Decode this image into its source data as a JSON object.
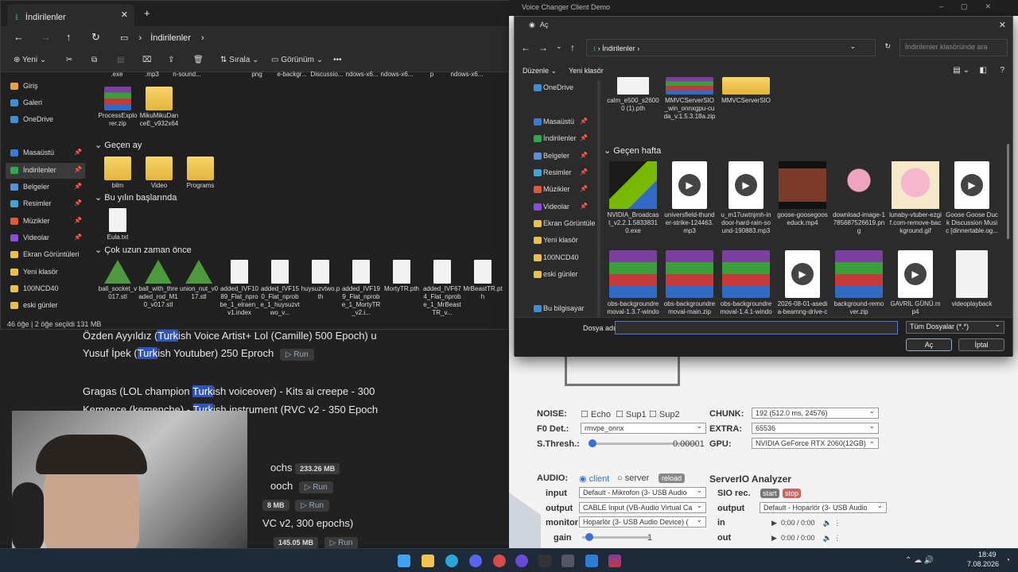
{
  "explorer": {
    "tab_title": "İndirilenler",
    "new_tab": "+",
    "address": "İndirilenler",
    "commands": {
      "new": "Yeni",
      "sort": "Sırala",
      "view": "Görünüm",
      "more": "•••"
    },
    "sidebar": [
      {
        "label": "Giriş",
        "color": "#e8a33c",
        "pinned": false
      },
      {
        "label": "Galeri",
        "color": "#3f8ed8",
        "pinned": false
      },
      {
        "label": "OneDrive",
        "color": "#3f8ed8",
        "pinned": false
      },
      {
        "label": "Masaüstü",
        "color": "#3a7bd5",
        "pinned": true
      },
      {
        "label": "İndirilenler",
        "color": "#2fa84f",
        "pinned": true
      },
      {
        "label": "Belgeler",
        "color": "#5a8fd8",
        "pinned": true
      },
      {
        "label": "Resimler",
        "color": "#3fa5d8",
        "pinned": true
      },
      {
        "label": "Müzikler",
        "color": "#e05a3a",
        "pinned": true
      },
      {
        "label": "Videolar",
        "color": "#8a4fd8",
        "pinned": true
      },
      {
        "label": "Ekran Görüntüleri",
        "color": "#e8c04a",
        "pinned": false
      },
      {
        "label": "Yeni klasör",
        "color": "#e8c04a",
        "pinned": false
      },
      {
        "label": "100NCD40",
        "color": "#e8c04a",
        "pinned": false
      },
      {
        "label": "eski günler",
        "color": "#e8c04a",
        "pinned": false
      }
    ],
    "top_row_cut": [
      ".exe",
      ".mp3",
      "n-sound...",
      "",
      "png",
      "e-backgr...",
      "Discussio...",
      "ndows-x6...",
      "ndows-x6...",
      "p",
      "ndows-x6..."
    ],
    "row1": [
      {
        "name": "ProcessExplorer.zip",
        "icon": "rar"
      },
      {
        "name": "MikuMikuDanceE_v932x64",
        "icon": "folder"
      }
    ],
    "group_last_month": "Geçen ay",
    "row2": [
      {
        "name": "bilm",
        "icon": "folder"
      },
      {
        "name": "Video",
        "icon": "folder"
      },
      {
        "name": "Programs",
        "icon": "folder"
      }
    ],
    "group_this_year": "Bu yılın başlarında",
    "row3": [
      {
        "name": "Eula.txt",
        "icon": "doc"
      }
    ],
    "group_long_ago": "Çok uzun zaman önce",
    "row4": [
      {
        "name": "ball_socket_v017.stl",
        "icon": "stl"
      },
      {
        "name": "ball_with_threaded_rod_M10_v017.stl",
        "icon": "stl"
      },
      {
        "name": "union_nut_v017.stl",
        "icon": "stl"
      },
      {
        "name": "added_IVF1089_Flat_nprobe_1_elraen_v1.index",
        "icon": "doc"
      },
      {
        "name": "added_IVF150_Flat_nprobe_1_huysuzvtwo_v...",
        "icon": "doc"
      },
      {
        "name": "huysuzvtwo.pth",
        "icon": "doc"
      },
      {
        "name": "added_IVF199_Flat_nprobe_1_MortyTR_v2.i...",
        "icon": "doc"
      },
      {
        "name": "MortyTR.pth",
        "icon": "doc"
      },
      {
        "name": "added_IVF674_Flat_nprobe_1_MrBeastTR_v...",
        "icon": "doc"
      },
      {
        "name": "MrBeastTR.pth",
        "icon": "doc"
      }
    ],
    "status": "46 öğe   |   2 öğe seçildi  131 MB"
  },
  "bgpage": {
    "line1_a": "Özden Ayyıldız (",
    "line1_hl": "Turk",
    "line1_b": "ish Voice Artist+ Lol (Camille) 500 Epoch) u",
    "line2_a": "Yusuf İpek (",
    "line2_hl": "Turk",
    "line2_b": "ish Youtuber) 250 Eproch",
    "line3_a": "Gragas (LOL champion ",
    "line3_hl": "Turk",
    "line3_b": "ish voiceover) - Kits ai creepe - 300",
    "line4_a": "Kemence (kemenche) - ",
    "line4_hl": "Turk",
    "line4_b": "ish instrument (RVC v2 - 350 Epoch",
    "line5": "ochs",
    "line6": "ooch",
    "line7": "VC v2, 300 epochs)",
    "run": "▷ Run",
    "sizes": [
      "233.26 MB",
      "8 MB",
      "145.05 MB"
    ]
  },
  "vc": {
    "window_title": "Voice Changer Client Demo",
    "noise_label": "NOISE:",
    "echo": "Echo",
    "sup1": "Sup1",
    "sup2": "Sup2",
    "f0_label": "F0 Det.:",
    "f0_value": "rmvpe_onnx",
    "sthresh_label": "S.Thresh.:",
    "sthresh_value": "0.00001",
    "chunk_label": "CHUNK:",
    "chunk_value": "192 (512.0 ms, 24576)",
    "extra_label": "EXTRA:",
    "extra_value": "65536",
    "gpu_label": "GPU:",
    "gpu_value": "NVIDIA GeForce RTX 2060(12GB)",
    "audio_label": "AUDIO:",
    "client": "client",
    "server": "server",
    "reload": "reload",
    "input_label": "input",
    "input_value": "Default - Mikrofon (3- USB Audio",
    "output_label": "output",
    "output_value": "CABLE Input (VB-Audio Virtual Ca",
    "monitor_label": "monitor",
    "monitor_value": "Hoparlör (3- USB Audio Device) (",
    "gain_label": "gain",
    "gain_value": "1",
    "analyzer_title": "ServerIO Analyzer",
    "sio_label": "SIO rec.",
    "start": "start",
    "stop": "stop",
    "an_output_label": "output",
    "an_output_value": "Default - Hoparlör (3- USB Audio",
    "in_label": "in",
    "out_label": "out",
    "time_in": "0:00 / 0:00",
    "time_out": "0:00 / 0:00"
  },
  "dialog": {
    "title": "Aç",
    "address": "İndirilenler",
    "search_placeholder": "İndirilenler klasöründe ara",
    "organize": "Düzenle",
    "new_folder": "Yeni klasör",
    "sidebar": [
      {
        "label": "OneDrive",
        "color": "#3f8ed8"
      },
      {
        "label": "Masaüstü",
        "color": "#3a7bd5"
      },
      {
        "label": "İndirilenler",
        "color": "#2fa84f"
      },
      {
        "label": "Belgeler",
        "color": "#5a8fd8"
      },
      {
        "label": "Resimler",
        "color": "#3fa5d8"
      },
      {
        "label": "Müzikler",
        "color": "#e05a3a"
      },
      {
        "label": "Videolar",
        "color": "#8a4fd8"
      },
      {
        "label": "Ekran Görüntüle",
        "color": "#e8c04a"
      },
      {
        "label": "Yeni klasör",
        "color": "#e8c04a"
      },
      {
        "label": "100NCD40",
        "color": "#e8c04a"
      },
      {
        "label": "eski günler",
        "color": "#e8c04a"
      },
      {
        "label": "Bu bilgisayar",
        "color": "#3f8ed8"
      }
    ],
    "top_row": [
      {
        "name": "calm_e500_s26000 (1).pth",
        "icon": "doc"
      },
      {
        "name": "MMVCServerSIO_win_onnxgpu-cuda_v.1.5.3.18a.zip",
        "icon": "rar"
      },
      {
        "name": "MMVCServerSIO",
        "icon": "folder"
      }
    ],
    "group_last_week": "Geçen hafta",
    "row1": [
      {
        "name": "NVIDIA_Broadcast_v2.2.1.58338310.exe",
        "icon": "nvidia"
      },
      {
        "name": "universfield-thunder-strike-124463.mp3",
        "icon": "video"
      },
      {
        "name": "u_m17uwtnjmh-indoor-hard-rain-sound-190883.mp3",
        "icon": "video"
      },
      {
        "name": "goose-goosegooseduck.mp4",
        "icon": "movie"
      },
      {
        "name": "download-image-1785687526619.png",
        "icon": "pink"
      },
      {
        "name": "lunaby-vtuber-ezgif.com-remove-background.gif",
        "icon": "pink2"
      },
      {
        "name": "Goose Goose Duck Discussion Music [dinnertable.og...",
        "icon": "video"
      }
    ],
    "row2": [
      {
        "name": "obs-backgroundremoval-1.3.7-windows-x64.zip",
        "icon": "rar"
      },
      {
        "name": "obs-backgroundremoval-main.zip",
        "icon": "rar"
      },
      {
        "name": "obs-backgroundremoval-1.4.1-windows-x64.zip",
        "icon": "rar"
      },
      {
        "name": "2026-08-01-asedia-beamng-drive-cekici-ve-yuk-tasma-gunu-d.mp4",
        "icon": "video"
      },
      {
        "name": "background-remover.zip",
        "icon": "rar"
      },
      {
        "name": "GAVRİL GÜNÜ.mp4",
        "icon": "video"
      },
      {
        "name": "videoplayback",
        "icon": "doc"
      }
    ],
    "filename_label": "Dosya adı:",
    "filename_value": "",
    "filter": "Tüm Dosyalar (*.*)",
    "open": "Aç",
    "cancel": "İptal"
  },
  "taskbar": {
    "time": "18:49",
    "date": "7.08.2026"
  }
}
